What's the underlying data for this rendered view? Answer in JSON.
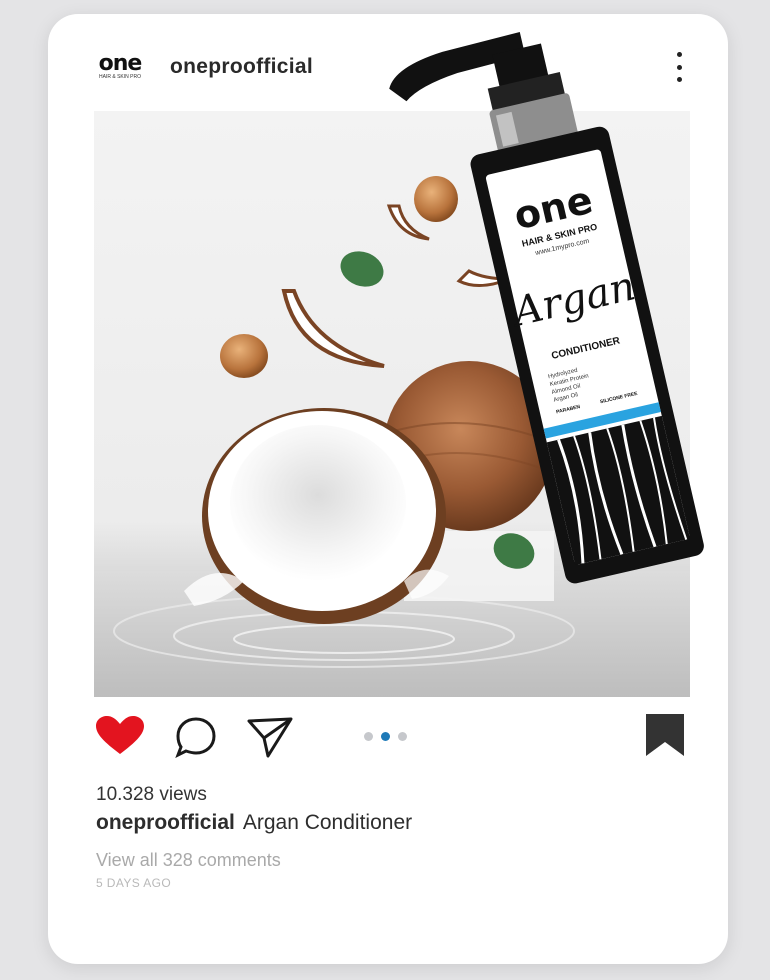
{
  "post": {
    "username": "oneproofficial",
    "avatar_logo": {
      "word": "one",
      "tagline": "HAIR & SKIN PRO"
    },
    "product": {
      "brand": "one",
      "line": "HAIR & SKIN PRO",
      "website": "www.1mypro.com",
      "name": "Argan",
      "type": "CONDITIONER",
      "ingredients": [
        "Hydrolyzed",
        "Keratin Protein",
        "Almond Oil",
        "Argan Oil"
      ],
      "badges": [
        "PARABEN",
        "SILICONE FREE"
      ]
    },
    "carousel": {
      "count": 3,
      "active_index": 1
    },
    "views": "10.328 views",
    "caption": {
      "user": "oneproofficial",
      "text": "Argan Conditioner"
    },
    "view_comments": "View all 328 comments",
    "time_ago": "5 DAYS AGO",
    "liked": true
  },
  "colors": {
    "like_red": "#e3141f",
    "carousel_active": "#1f7ab8",
    "bottle_black": "#111111",
    "label_blue": "#2aa3e0"
  },
  "icons": [
    "more-vertical-icon",
    "heart-icon",
    "comment-icon",
    "share-icon",
    "bookmark-icon"
  ]
}
